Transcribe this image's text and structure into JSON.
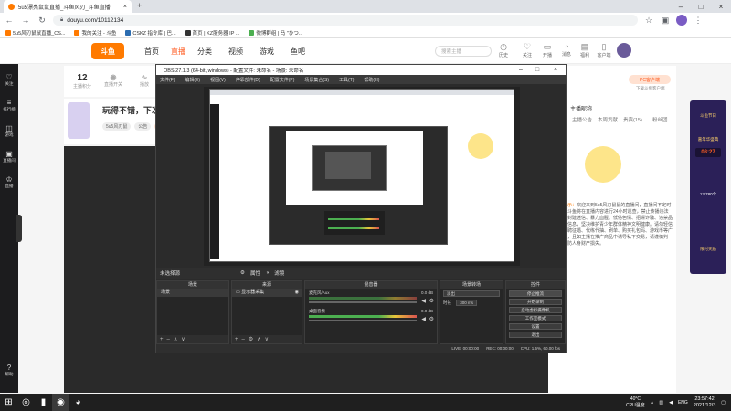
{
  "browser": {
    "tabs": [
      {
        "title": "5u5漂亮鼠鼠直播_斗鱼风刃_斗鱼直播"
      },
      {
        "title": ""
      }
    ],
    "url": "douyu.com/10112134",
    "bookmarks": [
      {
        "label": "5u5风刃鼠鼠直播_CS...",
        "color": "#ff7a00"
      },
      {
        "label": "我的关注 - 斗鱼",
        "color": "#ff7a00"
      },
      {
        "label": "CSKZ 指令库 | 巴...",
        "color": "#2b6cb0"
      },
      {
        "label": "首页 | KZ服务器 IP ...",
        "color": "#333"
      },
      {
        "label": "微博群组 | 马 \"ひつ...",
        "color": "#4caf50"
      }
    ]
  },
  "site": {
    "logo": "斗鱼",
    "nav": [
      "首页",
      "直播",
      "分类",
      "视频",
      "游戏",
      "鱼吧"
    ],
    "nav_active": 1,
    "search_placeholder": "搜索主播",
    "header_icons": [
      {
        "label": "历史",
        "icon": "clock-icon"
      },
      {
        "label": "关注",
        "icon": "heart-icon"
      },
      {
        "label": "开播",
        "icon": "camera-icon"
      },
      {
        "label": "消息",
        "icon": "bell-icon"
      },
      {
        "label": "福利",
        "icon": "gift-icon"
      },
      {
        "label": "客户端",
        "icon": "phone-icon"
      }
    ],
    "left_rail": [
      {
        "label": "关注",
        "icon": "heart-icon"
      },
      {
        "label": "排行榜",
        "icon": "ranking-icon"
      },
      {
        "label": "游戏",
        "icon": "gamepad-icon"
      },
      {
        "label": "直播间",
        "icon": "tv-icon"
      },
      {
        "label": "直播",
        "icon": "trophy-icon"
      },
      {
        "label": "帮助",
        "icon": "help-icon"
      }
    ],
    "room_stats": [
      {
        "value": "12",
        "label": "主播积分"
      },
      {
        "value": "",
        "label": "直播开关"
      },
      {
        "value": "",
        "label": "播放"
      }
    ],
    "stream_title": "玩得不错，下次还",
    "stream_tags": [
      "5u5风刃鼠",
      "公告",
      "日语"
    ],
    "right": {
      "pc_button": "PC客户端",
      "pc_sub": "下载斗鱼客户端",
      "title": "主播昵称",
      "tabs": [
        "主播公告",
        "本周贡献",
        "贵宾(15)",
        "粉丝团"
      ],
      "desc_highlight": "主播提示：",
      "desc": "欢迎来到5u5风刃鼠鼠的直播间，直播间不定时开播，斗鱼将在直播内容进行24小时巡查，禁止传播违法违规、封建迷信、暴力血腥、低俗色情、招嫖诈骗、违禁品等不良信息，坚决维护青少年群体精神文明健康。请勿轻信各类招聘征婚、代练代抽、刷单、购买礼包码、游戏币等广告信息，且如主播在推广商品中诱导私下交易，请谨慎判断，以防人身财产损失。"
    },
    "ad": {
      "badge": "斗鱼节日",
      "timer": "08:27",
      "line1": "嘉年华盛典",
      "line2": "13/780个",
      "line3": "限时奖励"
    }
  },
  "obs": {
    "title": "OBS 27.1.3 (64-bit, windows) - 配置文件: 未命名 - 场景: 未命名",
    "menu": [
      "文件(F)",
      "编辑(E)",
      "视图(V)",
      "停靠部件(D)",
      "配置文件(P)",
      "场景集合(S)",
      "工具(T)",
      "帮助(H)"
    ],
    "toolbar": [
      "未选择源",
      "属性",
      "滤镜"
    ],
    "panels": {
      "scenes": {
        "title": "场景",
        "items": [
          "场景"
        ]
      },
      "sources": {
        "title": "来源",
        "items": [
          "显示器采集"
        ]
      },
      "mixer": {
        "title": "混音器",
        "tracks": [
          {
            "name": "桌面音频",
            "level": "0.0 dB"
          },
          {
            "name": "麦克风/Aux",
            "level": "0.0 dB"
          }
        ]
      },
      "transitions": {
        "title": "场景转场",
        "type": "淡出",
        "duration_label": "时长",
        "duration": "300 ms"
      },
      "controls": {
        "title": "控件",
        "buttons": [
          "停止推流",
          "开始录制",
          "启动虚拟摄像机",
          "工作室模式",
          "设置",
          "退出"
        ]
      }
    },
    "status": [
      "LIVE: 00:00:00",
      "REC: 00:00:00",
      "CPU: 1.5%, 60.00 fps"
    ]
  },
  "taskbar": {
    "tray_temp": "40°C",
    "tray_cpu": "CPU温度",
    "ime": "ENG",
    "time": "23:57:42",
    "date": "2021/12/3"
  }
}
